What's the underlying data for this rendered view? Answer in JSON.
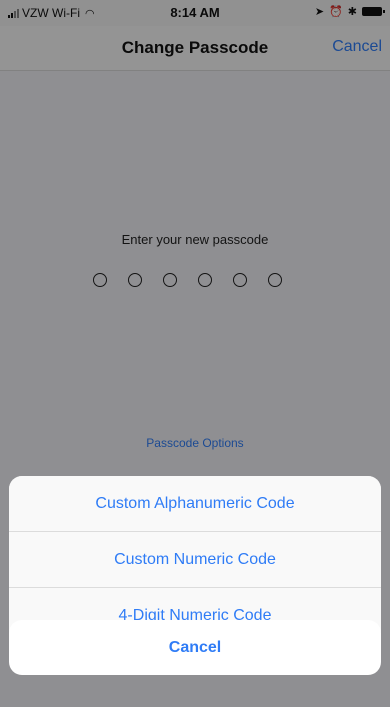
{
  "status_bar": {
    "carrier": "VZW Wi-Fi",
    "time": "8:14 AM"
  },
  "nav": {
    "title": "Change Passcode",
    "cancel_label": "Cancel"
  },
  "main": {
    "prompt": "Enter your new passcode",
    "passcode_dots": 6,
    "options_link": "Passcode Options"
  },
  "action_sheet": {
    "items": [
      {
        "label": "Custom Alphanumeric Code"
      },
      {
        "label": "Custom Numeric Code"
      },
      {
        "label": "4-Digit Numeric Code"
      }
    ],
    "cancel_label": "Cancel"
  },
  "colors": {
    "accent": "#2f7cf6",
    "background": "#efeff4"
  }
}
